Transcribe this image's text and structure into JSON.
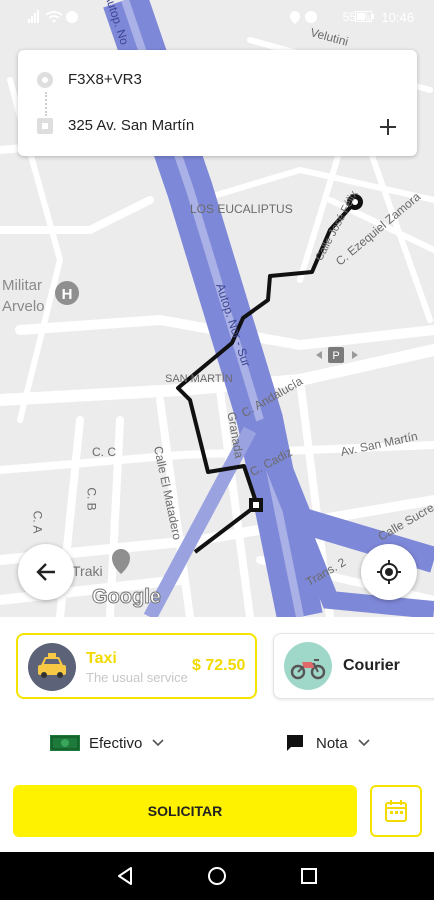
{
  "status_bar": {
    "battery": "55 %",
    "time": "10:46"
  },
  "route": {
    "origin": "F3X8+VR3",
    "destination": "325 Av. San Martín"
  },
  "map": {
    "labels": {
      "los_eucaliptus": "LOS EUCALIPTUS",
      "militar": "Militar",
      "arvelo": "Arvelo",
      "san_martin": "SAN MARTÍN",
      "c_andalucia": "C. Andalucía",
      "granada": "Granada",
      "c_cadiz": "C. Cadiz",
      "av_san_martin": "Av. San Martín",
      "calle_sucre": "Calle Sucre",
      "trans": "Trans. 2",
      "c_c": "C. C",
      "c_b": "C. B",
      "c_a": "C. A",
      "calle_el_matadero": "Calle El Matadero",
      "autop": "Autop. Nor - Sur",
      "c_ezequiel_zamora": "C. Ezequiel Zamora",
      "calle_jose_lope": "Calle José Félix",
      "taxi_poi": "Traki",
      "velutini": "Velutini",
      "autop_top": "Autop. No",
      "google": "Google"
    }
  },
  "services": [
    {
      "title": "Taxi",
      "subtitle": "The usual service",
      "price": "$ 72.50"
    },
    {
      "title": "Courier"
    }
  ],
  "payment": {
    "label": "Efectivo"
  },
  "note": {
    "label": "Nota"
  },
  "request_button": "SOLICITAR",
  "colors": {
    "accent": "#FFF200",
    "route": "#111111",
    "highway": "#7F89D9"
  }
}
